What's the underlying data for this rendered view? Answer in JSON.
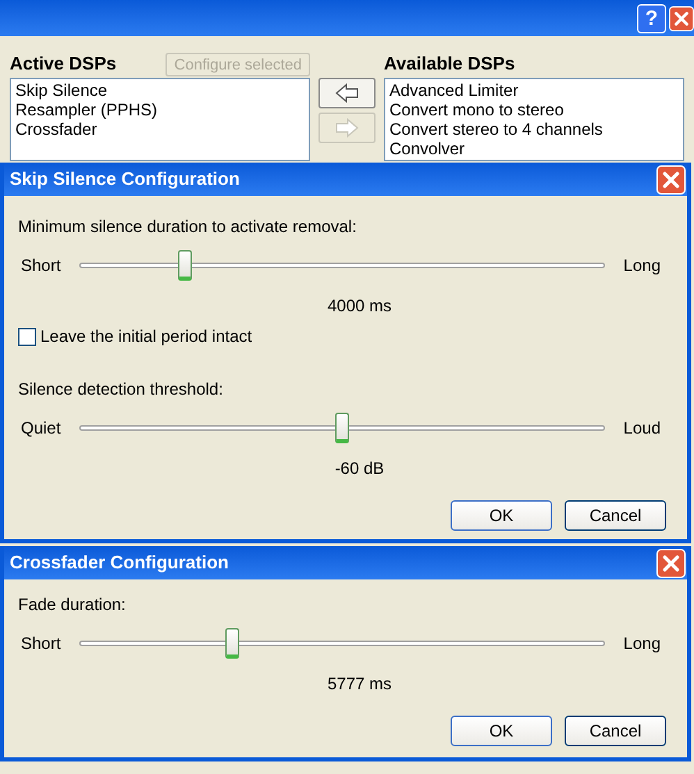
{
  "main_window": {
    "help_button": "?",
    "active_dsps": {
      "label": "Active DSPs",
      "configure_button": {
        "label": "Configure selected",
        "disabled": true
      },
      "items": [
        "Skip Silence",
        "Resampler (PPHS)",
        "Crossfader"
      ]
    },
    "move_buttons": [
      {
        "kind": "left",
        "disabled": false
      },
      {
        "kind": "right",
        "disabled": true
      }
    ],
    "available_dsps": {
      "label": "Available DSPs",
      "items": [
        "Advanced Limiter",
        "Convert mono to stereo",
        "Convert stereo to 4 channels",
        "Convolver"
      ]
    }
  },
  "dialogs": [
    {
      "title": "Skip Silence Configuration",
      "sections": [
        {
          "kind": "slider",
          "label": "Minimum silence duration to activate removal:",
          "min_label": "Short",
          "max_label": "Long",
          "level": 0.2,
          "reading": "4000 ms"
        },
        {
          "kind": "checkbox",
          "label": "Leave the initial period intact",
          "checked": false
        },
        {
          "kind": "slider",
          "label": "Silence detection threshold:",
          "min_label": "Quiet",
          "max_label": "Loud",
          "level": 0.5,
          "reading": "-60 dB"
        }
      ],
      "buttons": [
        "OK",
        "Cancel"
      ]
    },
    {
      "title": "Crossfader Configuration",
      "sections": [
        {
          "kind": "slider",
          "label": "Fade duration:",
          "min_label": "Short",
          "max_label": "Long",
          "level": 0.29,
          "reading": "5777 ms"
        }
      ],
      "buttons": [
        "OK",
        "Cancel"
      ]
    }
  ]
}
